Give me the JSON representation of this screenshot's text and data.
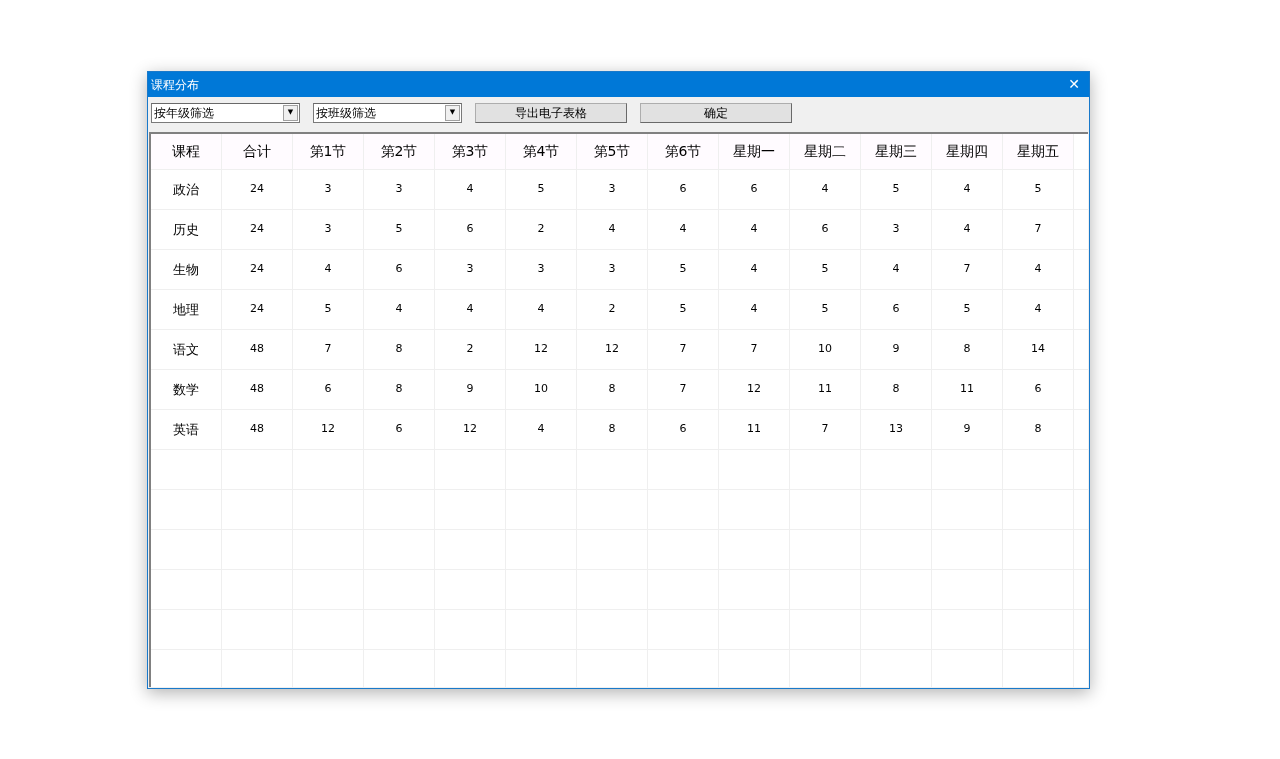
{
  "window": {
    "title": "课程分布",
    "close": "✕"
  },
  "toolbar": {
    "dropdowns": [
      {
        "value": "按年级筛选",
        "arrow": "▼"
      },
      {
        "value": "按班级筛选",
        "arrow": "▼"
      }
    ],
    "buttons": [
      "导出电子表格",
      "确定"
    ]
  },
  "table": {
    "columns": [
      "课程",
      "合计",
      "第1节",
      "第2节",
      "第3节",
      "第4节",
      "第5节",
      "第6节",
      "星期一",
      "星期二",
      "星期三",
      "星期四",
      "星期五"
    ],
    "rows": [
      [
        "政治",
        "24",
        "3",
        "3",
        "4",
        "5",
        "3",
        "6",
        "6",
        "4",
        "5",
        "4",
        "5"
      ],
      [
        "历史",
        "24",
        "3",
        "5",
        "6",
        "2",
        "4",
        "4",
        "4",
        "6",
        "3",
        "4",
        "7"
      ],
      [
        "生物",
        "24",
        "4",
        "6",
        "3",
        "3",
        "3",
        "5",
        "4",
        "5",
        "4",
        "7",
        "4"
      ],
      [
        "地理",
        "24",
        "5",
        "4",
        "4",
        "4",
        "2",
        "5",
        "4",
        "5",
        "6",
        "5",
        "4"
      ],
      [
        "语文",
        "48",
        "7",
        "8",
        "2",
        "12",
        "12",
        "7",
        "7",
        "10",
        "9",
        "8",
        "14"
      ],
      [
        "数学",
        "48",
        "6",
        "8",
        "9",
        "10",
        "8",
        "7",
        "12",
        "11",
        "8",
        "11",
        "6"
      ],
      [
        "英语",
        "48",
        "12",
        "6",
        "12",
        "4",
        "8",
        "6",
        "11",
        "7",
        "13",
        "9",
        "8"
      ]
    ]
  }
}
